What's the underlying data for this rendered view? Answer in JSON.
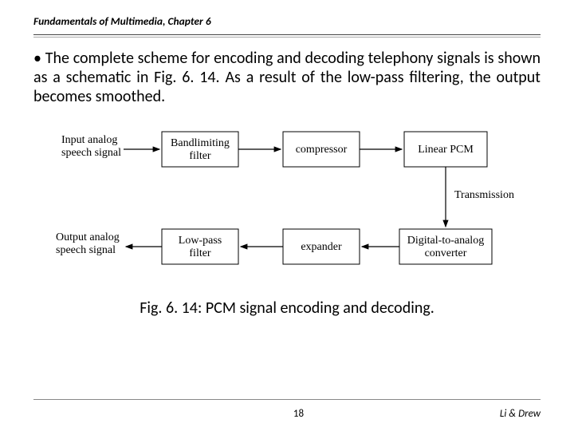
{
  "header": "Fundamentals of Multimedia, Chapter 6",
  "body": {
    "bullet": "•",
    "text": "The complete scheme for encoding and decoding telephony signals is shown as a schematic in Fig. 6. 14. As a result of the low-pass filtering, the output becomes smoothed."
  },
  "diagram": {
    "input_l1": "Input analog",
    "input_l2": "speech signal",
    "box1_l1": "Bandlimiting",
    "box1_l2": "filter",
    "box2": "compressor",
    "box3": "Linear PCM",
    "transmission": "Transmission",
    "box4_l1": "Digital-to-analog",
    "box4_l2": "converter",
    "box5": "expander",
    "box6_l1": "Low-pass",
    "box6_l2": "filter",
    "output_l1": "Output analog",
    "output_l2": "speech signal"
  },
  "caption": "Fig. 6. 14: PCM signal encoding and decoding.",
  "footer": {
    "page": "18",
    "authors": "Li & Drew"
  }
}
